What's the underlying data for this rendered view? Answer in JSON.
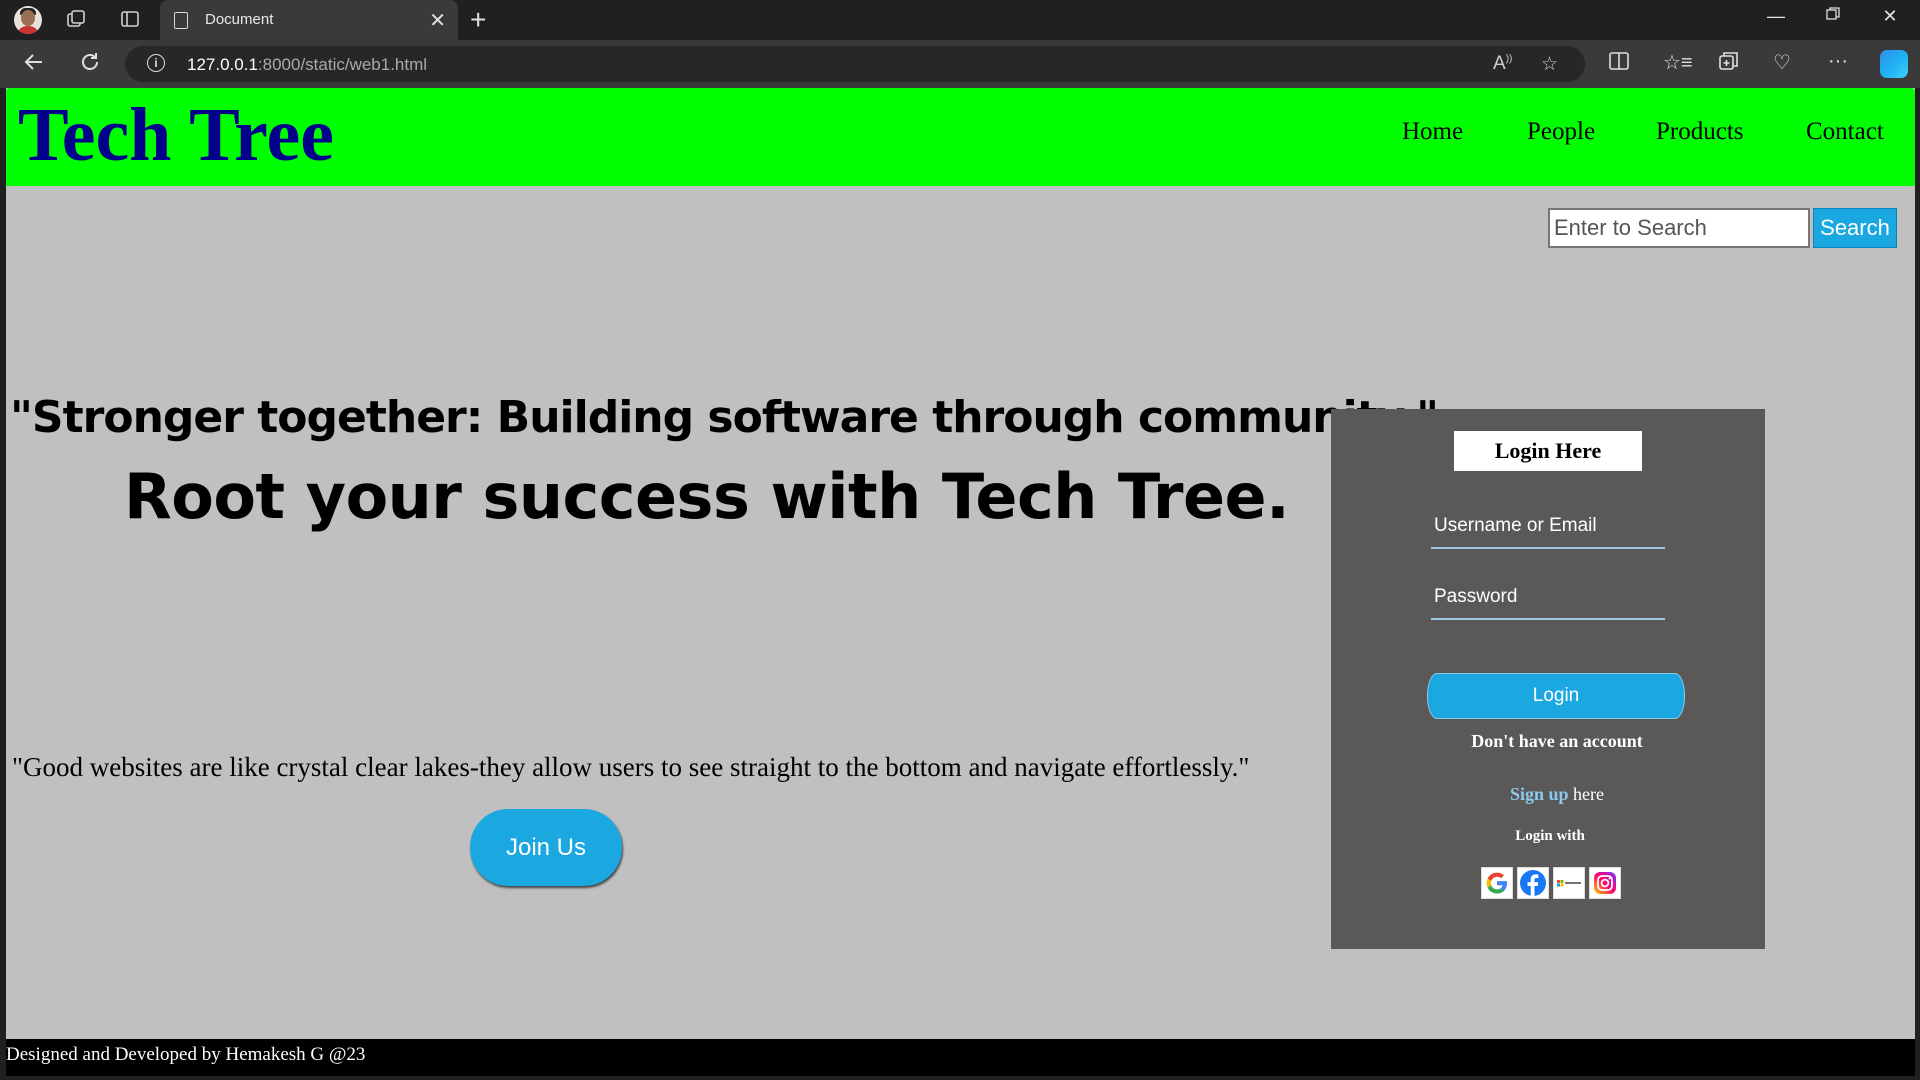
{
  "browser": {
    "tab_title": "Document",
    "url_host": "127.0.0.1",
    "url_rest": ":8000/static/web1.html"
  },
  "site": {
    "brand": "Tech Tree",
    "menu": [
      "Home",
      "People",
      "Products",
      "Contact"
    ],
    "search_placeholder": "Enter to Search",
    "search_button": "Search",
    "quote1": "\"Stronger together: Building software through community.\"",
    "tagline": "Root your success with Tech Tree.",
    "quote2": "\"Good websites are like crystal clear lakes-they allow users to see straight to the bottom and navigate effortlessly.\"",
    "join_button": "Join Us"
  },
  "login": {
    "title": "Login Here",
    "username_placeholder": "Username or Email",
    "password_placeholder": "Password",
    "button": "Login",
    "no_account": "Don't have an account",
    "signup_link": "Sign up",
    "signup_suffix": " here",
    "login_with": "Login with",
    "providers": [
      "Google",
      "Facebook",
      "Microsoft",
      "Instagram"
    ]
  },
  "footer": {
    "text": "Designed and Developed by Hemakesh G @23"
  },
  "colors": {
    "header_bg": "#00ff00",
    "brand": "#00008b",
    "page_bg": "#c0c0c0",
    "accent": "#1ba7e0",
    "login_panel": "#5a5958"
  }
}
